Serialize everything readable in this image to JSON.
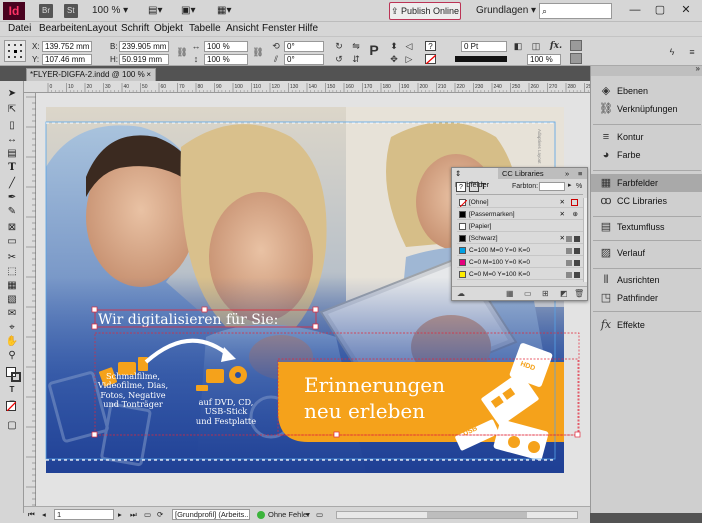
{
  "app": {
    "logo": "Id",
    "bridge": "Br",
    "stock": "St",
    "zoom": "100 %"
  },
  "titlebar": {
    "publish_label": "Publish Online",
    "workspace": "Grundlagen",
    "search_placeholder": "",
    "minimize": "—",
    "restore": "▢",
    "close": "✕"
  },
  "menu": [
    "Datei",
    "Bearbeiten",
    "Layout",
    "Schrift",
    "Objekt",
    "Tabelle",
    "Ansicht",
    "Fenster",
    "Hilfe"
  ],
  "control": {
    "x_label": "X:",
    "x_value": "139.752 mm",
    "y_label": "Y:",
    "y_value": "107.46 mm",
    "w_label": "B:",
    "w_value": "239.905 mm",
    "h_label": "H:",
    "h_value": "50.919 mm",
    "scale_x": "100 %",
    "scale_y": "100 %",
    "rotate": "0°",
    "shear": "0°",
    "stroke": "0 Pt",
    "opacity": "100 %",
    "fx": "fx."
  },
  "doctab": {
    "label": "*FLYER-DIGFA-2.indd @ 100 %",
    "close": "×"
  },
  "ruler_ticks": [
    "0",
    "10",
    "20",
    "30",
    "40",
    "50",
    "60",
    "70",
    "80",
    "90",
    "100",
    "110",
    "120",
    "130",
    "140",
    "150",
    "160",
    "170",
    "180",
    "190",
    "200",
    "210",
    "220",
    "230",
    "240",
    "250",
    "260",
    "270",
    "280",
    "290",
    "300"
  ],
  "panel": {
    "items": [
      {
        "icon": "layers-icon",
        "label": "Ebenen"
      },
      {
        "icon": "links-icon",
        "label": "Verknüpfungen"
      },
      {
        "icon": "stroke-icon",
        "label": "Kontur"
      },
      {
        "icon": "color-icon",
        "label": "Farbe"
      },
      {
        "icon": "swatches-icon",
        "label": "Farbfelder"
      },
      {
        "icon": "cc-libraries-icon",
        "label": "CC Libraries"
      },
      {
        "icon": "text-wrap-icon",
        "label": "Textumfluss"
      },
      {
        "icon": "gradient-icon",
        "label": "Verlauf"
      },
      {
        "icon": "align-icon",
        "label": "Ausrichten"
      },
      {
        "icon": "pathfinder-icon",
        "label": "Pathfinder"
      },
      {
        "icon": "effects-icon",
        "label": "Effekte"
      }
    ]
  },
  "swatches": {
    "tab_active": "Farbfelder",
    "tab_other": "CC Libraries",
    "tint_label": "Farbton:",
    "tint_unit": "%",
    "rows": [
      {
        "name": "[Ohne]",
        "color": "#ffffff"
      },
      {
        "name": "[Passermarken]",
        "color": "#000000"
      },
      {
        "name": "[Papier]",
        "color": "#ffffff"
      },
      {
        "name": "[Schwarz]",
        "color": "#000000"
      },
      {
        "name": "C=100 M=0 Y=0 K=0",
        "color": "#00a0e3"
      },
      {
        "name": "C=0 M=100 Y=0 K=0",
        "color": "#e4007d"
      },
      {
        "name": "C=0 M=0 Y=100 K=0",
        "color": "#ffec00"
      }
    ]
  },
  "artwork": {
    "headline": "Wir digitalisieren für Sie:",
    "left_lines": [
      "Schmalfilme,",
      "Videofilme, Dias,",
      "Fotos, Negative",
      "und Tonträger"
    ],
    "mid_lines": [
      "auf DVD, CD,",
      "USB-Stick",
      "und Festplatte"
    ],
    "cta_line1": "Erinnerungen",
    "cta_line2": "neu erleben",
    "badge_hdd": "HDD",
    "badge_usb": "USB",
    "side_label": "Adaptives Layout"
  },
  "status": {
    "page": "1",
    "profile": "[Grundprofil] (Arbeits...",
    "errors": "Ohne Fehler"
  },
  "colors": {
    "accent_orange": "#f5a21b",
    "panel_bg": "#cfcfcf",
    "ui_bg": "#d6d6d6"
  }
}
